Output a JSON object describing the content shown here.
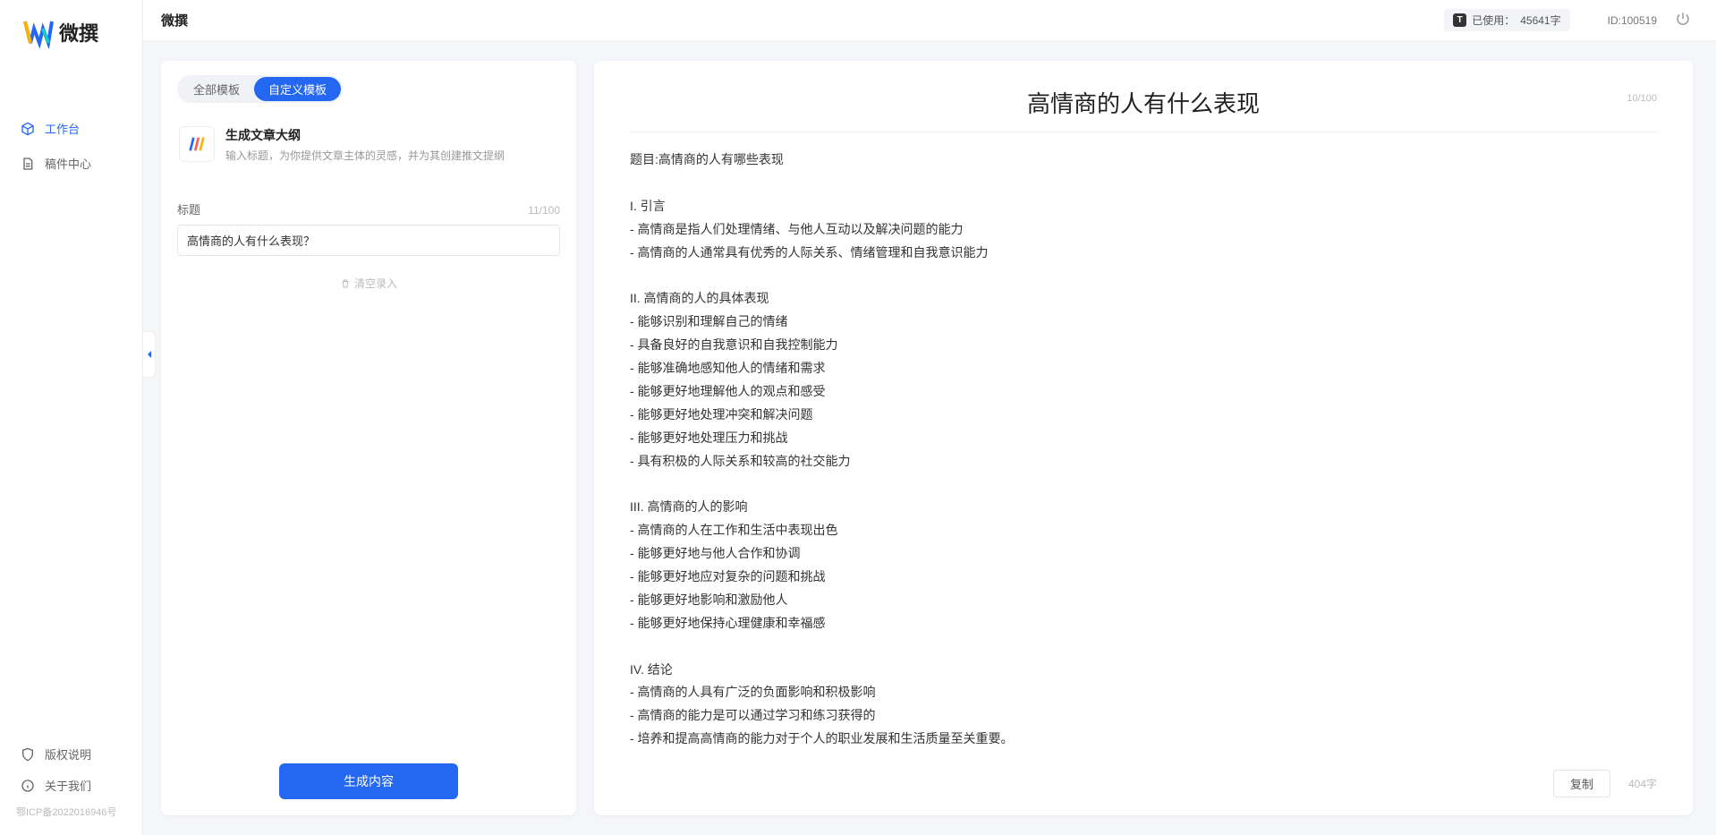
{
  "app": {
    "name": "微撰",
    "logo_text": "微撰"
  },
  "sidebar": {
    "nav": [
      {
        "label": "工作台",
        "icon": "cube"
      },
      {
        "label": "稿件中心",
        "icon": "doc"
      }
    ],
    "bottom": [
      {
        "label": "版权说明",
        "icon": "shield"
      },
      {
        "label": "关于我们",
        "icon": "info"
      }
    ],
    "icp": "鄂ICP备2022016946号"
  },
  "topbar": {
    "title": "微撰",
    "usage_prefix": "已使用：",
    "usage_value": "45641字",
    "id_label": "ID:100519"
  },
  "left": {
    "tabs": [
      {
        "label": "全部模板"
      },
      {
        "label": "自定义模板"
      }
    ],
    "template": {
      "title": "生成文章大纲",
      "desc": "输入标题，为你提供文章主体的灵感，并为其创建推文提纲"
    },
    "field_label": "标题",
    "field_count": "11/100",
    "title_value": "高情商的人有什么表现？",
    "clear_label": "清空录入",
    "generate_label": "生成内容"
  },
  "right": {
    "title": "高情商的人有什么表现",
    "title_count": "10/100",
    "body": "题目:高情商的人有哪些表现\n\nI. 引言\n- 高情商是指人们处理情绪、与他人互动以及解决问题的能力\n- 高情商的人通常具有优秀的人际关系、情绪管理和自我意识能力\n\nII. 高情商的人的具体表现\n- 能够识别和理解自己的情绪\n- 具备良好的自我意识和自我控制能力\n- 能够准确地感知他人的情绪和需求\n- 能够更好地理解他人的观点和感受\n- 能够更好地处理冲突和解决问题\n- 能够更好地处理压力和挑战\n- 具有积极的人际关系和较高的社交能力\n\nIII. 高情商的人的影响\n- 高情商的人在工作和生活中表现出色\n- 能够更好地与他人合作和协调\n- 能够更好地应对复杂的问题和挑战\n- 能够更好地影响和激励他人\n- 能够更好地保持心理健康和幸福感\n\nIV. 结论\n- 高情商的人具有广泛的负面影响和积极影响\n- 高情商的能力是可以通过学习和练习获得的\n- 培养和提高高情商的能力对于个人的职业发展和生活质量至关重要。",
    "copy_label": "复制",
    "word_count": "404字"
  }
}
